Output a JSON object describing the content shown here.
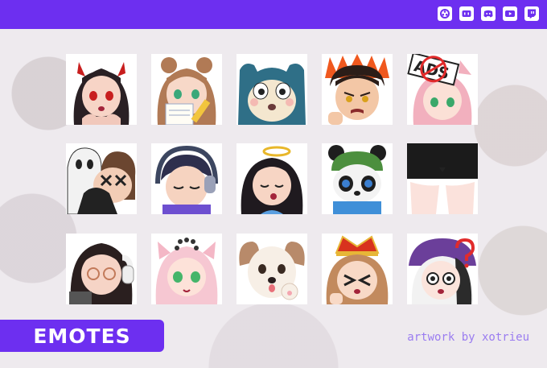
{
  "header": {
    "accent": "#6d2ff0",
    "icons": [
      "obs-icon",
      "streamlabs-icon",
      "discord-icon",
      "youtube-icon",
      "twitch-icon"
    ]
  },
  "emotes": [
    {
      "name": "devil-girl-emote"
    },
    {
      "name": "notepad-girl-emote"
    },
    {
      "name": "snorlax-emote"
    },
    {
      "name": "angry-boy-fire-emote"
    },
    {
      "name": "ads-sign-girl-emote"
    },
    {
      "name": "ghost-hug-emote"
    },
    {
      "name": "headphones-sleep-emote"
    },
    {
      "name": "angel-girl-emote"
    },
    {
      "name": "panda-hat-emote"
    },
    {
      "name": "maid-legs-emote"
    },
    {
      "name": "headphones-glasses-emote"
    },
    {
      "name": "pink-cat-girl-emote"
    },
    {
      "name": "puppy-paw-emote"
    },
    {
      "name": "crown-girl-emote"
    },
    {
      "name": "confused-witch-emote"
    }
  ],
  "badge": {
    "label": "EMOTES"
  },
  "credit": {
    "text": "artwork by xotrieu"
  }
}
